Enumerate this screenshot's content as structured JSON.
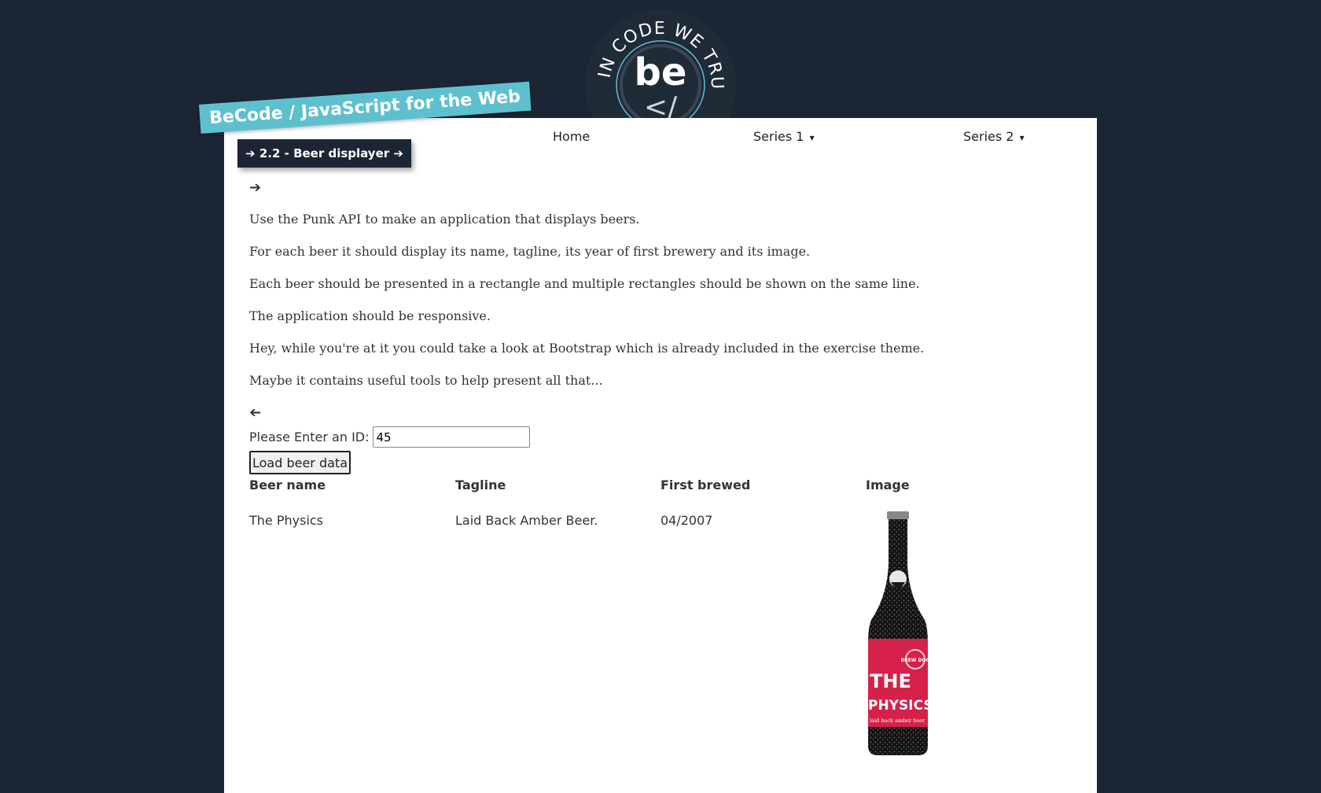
{
  "logo": {
    "ring_text": "IN CODE WE TRUST",
    "mark": "be",
    "glyph": "</"
  },
  "header": {
    "banner_title": "BeCode / JavaScript for the Web",
    "exercise_title": "➔ 2.2 - Beer displayer ➔"
  },
  "nav": {
    "items": [
      {
        "label": "Home"
      },
      {
        "label": "Series 1"
      },
      {
        "label": "Series 2"
      }
    ],
    "caret": "▾"
  },
  "content": {
    "open_arrow": "➔",
    "close_arrow": "➔",
    "paragraphs": [
      "Use the Punk API to make an application that displays beers.",
      "For each beer it should display its name, tagline, its year of first brewery and its image.",
      "Each beer should be presented in a rectangle and multiple rectangles should be shown on the same line.",
      "The application should be responsive.",
      "Hey, while you're at it you could take a look at Bootstrap which is already included in the exercise theme.",
      "Maybe it contains useful tools to help present all that..."
    ]
  },
  "form": {
    "label": "Please Enter an ID:",
    "id_value": "45",
    "button_label": "Load beer data"
  },
  "table": {
    "headers": [
      "Beer name",
      "Tagline",
      "First brewed",
      "Image"
    ],
    "row": {
      "name": "The Physics",
      "tagline": "Laid Back Amber Beer.",
      "first_brewed": "04/2007"
    }
  },
  "bottle_label": {
    "line1": "THE",
    "line2": "PHYSICS",
    "tagline": "laid back amber beer",
    "brand": "BREW DOG"
  },
  "colors": {
    "page_bg": "#1b2533",
    "accent": "#5ec0cf",
    "label_red": "#d5214a"
  }
}
